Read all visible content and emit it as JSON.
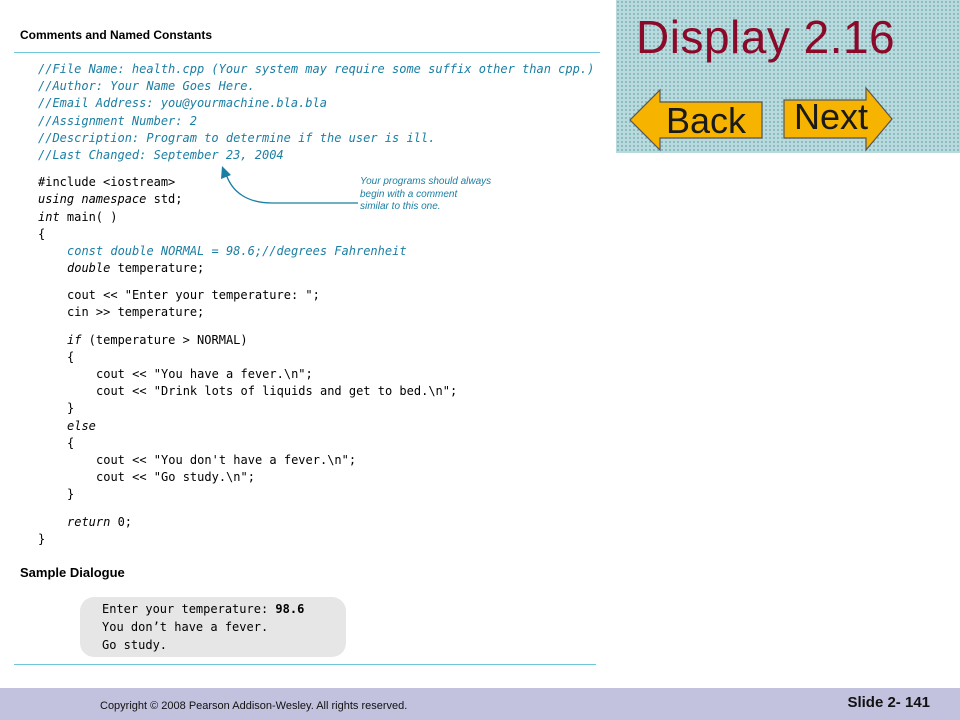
{
  "header": {
    "title": "Display 2.16",
    "back_label": "Back",
    "next_label": "Next",
    "panel_color": "#b9dadd",
    "title_color": "#8b0a2a",
    "button_color": "#f6b400"
  },
  "display": {
    "section_title": "Comments and Named Constants",
    "code": {
      "comments": [
        "//File Name: health.cpp (Your system may require some suffix other than cpp.)",
        "//Author: Your Name Goes Here.",
        "//Email Address: you@yourmachine.bla.bla",
        "//Assignment Number: 2",
        "//Description: Program to determine if the user is ill.",
        "//Last Changed: September 23, 2004"
      ],
      "include": "#include <iostream>",
      "using_kw": "using namespace",
      "using_rest": " std;",
      "int_kw": "int",
      "main_rest": " main( )",
      "open_brace": "{",
      "const_line": "const double NORMAL = 98.6;//degrees Fahrenheit",
      "double_kw": "double",
      "double_rest": " temperature;",
      "cout_prompt": "cout << \"Enter your temperature: \";",
      "cin_line": "cin >> temperature;",
      "if_kw": "if",
      "if_rest": " (temperature > NORMAL)",
      "inner_open1": "{",
      "cout_fever": "cout << \"You have a fever.\\n\";",
      "cout_drink": "cout << \"Drink lots of liquids and get to bed.\\n\";",
      "inner_close1": "}",
      "else_kw": "else",
      "inner_open2": "{",
      "cout_nofever": "cout << \"You don't have a fever.\\n\";",
      "cout_study": "cout << \"Go study.\\n\";",
      "inner_close2": "}",
      "return_kw": "return",
      "return_rest": " 0;",
      "close_brace": "}"
    },
    "annotation": [
      "Your programs should always",
      "begin with a comment",
      "similar to this one."
    ],
    "dialogue_title": "Sample Dialogue",
    "dialogue": {
      "prompt": "Enter your temperature: ",
      "input": "98.6",
      "line2": "You don’t have a fever.",
      "line3": "Go study."
    },
    "accent_color": "#1b7ea3"
  },
  "footer": {
    "copyright": "Copyright © 2008 Pearson Addison-Wesley.  All rights reserved.",
    "slide": "Slide 2- 141",
    "background": "#c2c2df"
  }
}
